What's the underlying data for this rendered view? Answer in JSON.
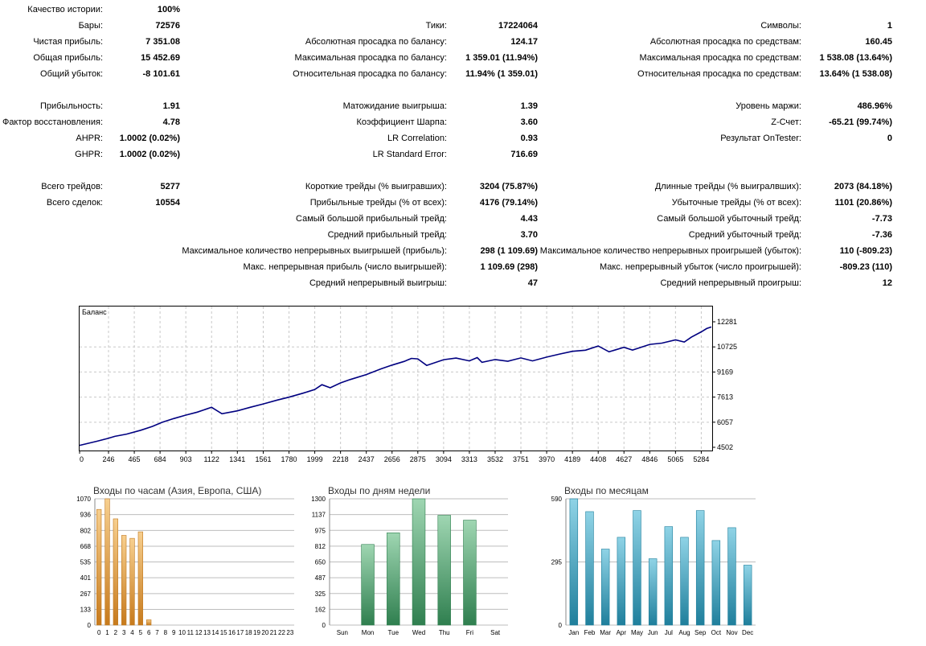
{
  "report": {
    "col1": [
      {
        "label": "Качество истории:",
        "value": "100%",
        "row": 0
      },
      {
        "label": "Бары:",
        "value": "72576",
        "row": 1
      },
      {
        "label": "Чистая прибыль:",
        "value": "7 351.08",
        "row": 2
      },
      {
        "label": "Общая прибыль:",
        "value": "15 452.69",
        "row": 3
      },
      {
        "label": "Общий убыток:",
        "value": "-8 101.61",
        "row": 4
      },
      {
        "label": "Прибыльность:",
        "value": "1.91",
        "row": 6
      },
      {
        "label": "Фактор восстановления:",
        "value": "4.78",
        "row": 7
      },
      {
        "label": "AHPR:",
        "value": "1.0002 (0.02%)",
        "row": 8
      },
      {
        "label": "GHPR:",
        "value": "1.0002 (0.02%)",
        "row": 9
      },
      {
        "label": "Всего трейдов:",
        "value": "5277",
        "row": 11
      },
      {
        "label": "Всего сделок:",
        "value": "10554",
        "row": 12
      }
    ],
    "col2": [
      {
        "label": "Тики:",
        "value": "17224064",
        "row": 1
      },
      {
        "label": "Абсолютная просадка по балансу:",
        "value": "124.17",
        "row": 2
      },
      {
        "label": "Максимальная просадка по балансу:",
        "value": "1 359.01 (11.94%)",
        "row": 3
      },
      {
        "label": "Относительная просадка по балансу:",
        "value": "11.94% (1 359.01)",
        "row": 4
      },
      {
        "label": "Матожидание выигрыша:",
        "value": "1.39",
        "row": 6
      },
      {
        "label": "Коэффициент Шарпа:",
        "value": "3.60",
        "row": 7
      },
      {
        "label": "LR Correlation:",
        "value": "0.93",
        "row": 8
      },
      {
        "label": "LR Standard Error:",
        "value": "716.69",
        "row": 9
      },
      {
        "label": "Короткие трейды (% выигравших):",
        "value": "3204 (75.87%)",
        "row": 11
      },
      {
        "label": "Прибыльные трейды (% от всех):",
        "value": "4176 (79.14%)",
        "row": 12
      },
      {
        "label": "Самый большой прибыльный трейд:",
        "value": "4.43",
        "row": 13
      },
      {
        "label": "Средний прибыльный трейд:",
        "value": "3.70",
        "row": 14
      },
      {
        "label": "Максимальное количество непрерывных выигрышей (прибыль):",
        "value": "298 (1 109.69)",
        "row": 15
      },
      {
        "label": "Макс. непрерывная прибыль (число выигрышей):",
        "value": "1 109.69 (298)",
        "row": 16
      },
      {
        "label": "Средний непрерывный выигрыш:",
        "value": "47",
        "row": 17
      }
    ],
    "col3": [
      {
        "label": "Символы:",
        "value": "1",
        "row": 1
      },
      {
        "label": "Абсолютная просадка по средствам:",
        "value": "160.45",
        "row": 2
      },
      {
        "label": "Максимальная просадка по средствам:",
        "value": "1 538.08 (13.64%)",
        "row": 3
      },
      {
        "label": "Относительная просадка по средствам:",
        "value": "13.64% (1 538.08)",
        "row": 4
      },
      {
        "label": "Уровень маржи:",
        "value": "486.96%",
        "row": 6
      },
      {
        "label": "Z-Счет:",
        "value": "-65.21 (99.74%)",
        "row": 7
      },
      {
        "label": "Результат OnTester:",
        "value": "0",
        "row": 8
      },
      {
        "label": "Длинные трейды (% выигралвших):",
        "value": "2073 (84.18%)",
        "row": 11
      },
      {
        "label": "Убыточные трейды (% от всех):",
        "value": "1101 (20.86%)",
        "row": 12
      },
      {
        "label": "Самый большой убыточный трейд:",
        "value": "-7.73",
        "row": 13
      },
      {
        "label": "Средний убыточный трейд:",
        "value": "-7.36",
        "row": 14
      },
      {
        "label": "Максимальное количество непрерывных проигрышей (убыток):",
        "value": "110 (-809.23)",
        "row": 15
      },
      {
        "label": "Макс. непрерывный убыток (число проигрышей):",
        "value": "-809.23 (110)",
        "row": 16
      },
      {
        "label": "Средний непрерывный проигрыш:",
        "value": "12",
        "row": 17
      }
    ]
  },
  "colors": {
    "balance_line": "#000080",
    "hours_bar": "#e8a13c",
    "days_bar": "#3e9a63",
    "months_bar": "#3aa6c2",
    "grid": "#c8c8c8"
  },
  "chart_data": [
    {
      "type": "line",
      "title": "Баланс",
      "xlabel": "",
      "ylabel": "",
      "xticks": [
        "0",
        "246",
        "465",
        "684",
        "903",
        "1122",
        "1341",
        "1561",
        "1780",
        "1999",
        "2218",
        "2437",
        "2656",
        "2875",
        "3094",
        "3313",
        "3532",
        "3751",
        "3970",
        "4189",
        "4408",
        "4627",
        "4846",
        "5065",
        "5284"
      ],
      "yticks": [
        "12281",
        "10725",
        "9169",
        "7613",
        "6057",
        "4502"
      ],
      "ylim": [
        4502,
        12281
      ],
      "grid": true,
      "series": [
        {
          "x": [
            0,
            150,
            240,
            300,
            400,
            520,
            620,
            700,
            800,
            900,
            1000,
            1122,
            1210,
            1341,
            1450,
            1561,
            1680,
            1780,
            1900,
            1999,
            2060,
            2130,
            2218,
            2300,
            2437,
            2560,
            2656,
            2760,
            2820,
            2875,
            2950,
            3094,
            3200,
            3313,
            3380,
            3420,
            3532,
            3640,
            3751,
            3850,
            3970,
            4080,
            4189,
            4300,
            4408,
            4500,
            4627,
            4700,
            4846,
            4950,
            5065,
            5140,
            5200,
            5284,
            5330,
            5370
          ],
          "y": [
            4620,
            4880,
            5050,
            5180,
            5320,
            5560,
            5800,
            6050,
            6280,
            6490,
            6680,
            6980,
            6580,
            6760,
            6980,
            7190,
            7430,
            7610,
            7860,
            8080,
            8380,
            8190,
            8490,
            8700,
            9010,
            9360,
            9600,
            9830,
            10010,
            9980,
            9580,
            9930,
            10030,
            9860,
            10060,
            9770,
            9940,
            9840,
            10040,
            9860,
            10090,
            10280,
            10450,
            10520,
            10780,
            10420,
            10700,
            10530,
            10880,
            10960,
            11160,
            11030,
            11330,
            11660,
            11860,
            11960
          ]
        }
      ]
    },
    {
      "type": "bar",
      "title": "Входы по часам (Азия, Европа, США)",
      "categories": [
        "0",
        "1",
        "2",
        "3",
        "4",
        "5",
        "6",
        "7",
        "8",
        "9",
        "10",
        "11",
        "12",
        "13",
        "14",
        "15",
        "16",
        "17",
        "18",
        "19",
        "20",
        "21",
        "22",
        "23"
      ],
      "values": [
        980,
        1070,
        900,
        760,
        735,
        790,
        45,
        0,
        0,
        0,
        0,
        0,
        0,
        0,
        0,
        0,
        0,
        0,
        0,
        0,
        0,
        0,
        0,
        0
      ],
      "yticks": [
        "1070",
        "936",
        "802",
        "668",
        "535",
        "401",
        "267",
        "133",
        "0"
      ],
      "ylim": [
        0,
        1070
      ]
    },
    {
      "type": "bar",
      "title": "Входы по дням недели",
      "categories": [
        "Sun",
        "Mon",
        "Tue",
        "Wed",
        "Thu",
        "Fri",
        "Sat"
      ],
      "values": [
        0,
        830,
        950,
        1300,
        1130,
        1080,
        0
      ],
      "yticks": [
        "1300",
        "1137",
        "975",
        "812",
        "650",
        "487",
        "325",
        "162",
        "0"
      ],
      "ylim": [
        0,
        1300
      ]
    },
    {
      "type": "bar",
      "title": "Входы по месяцам",
      "categories": [
        "Jan",
        "Feb",
        "Mar",
        "Apr",
        "May",
        "Jun",
        "Jul",
        "Aug",
        "Sep",
        "Oct",
        "Nov",
        "Dec"
      ],
      "values": [
        590,
        530,
        355,
        410,
        535,
        310,
        460,
        410,
        535,
        395,
        455,
        280
      ],
      "yticks": [
        "590",
        "295",
        "0"
      ],
      "ylim": [
        0,
        590
      ]
    }
  ]
}
